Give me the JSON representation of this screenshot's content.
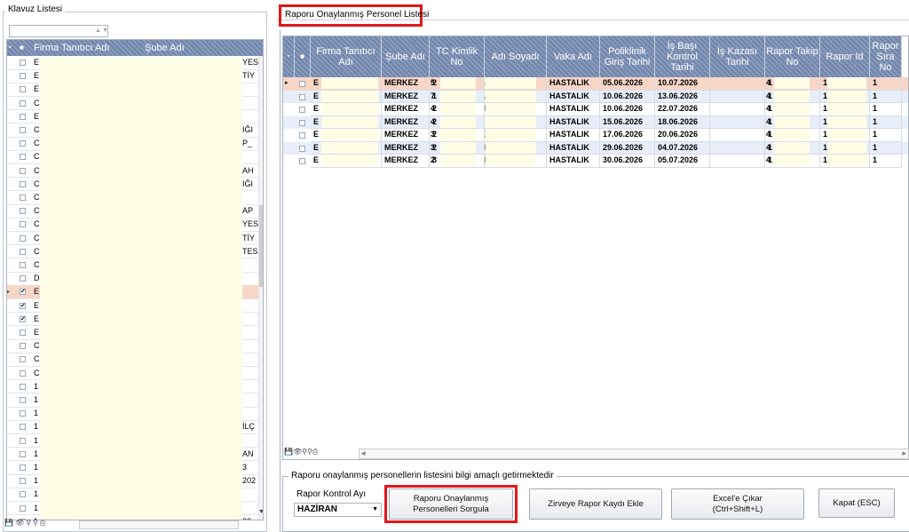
{
  "left_panel": {
    "title": "Klavuz Listesi",
    "columns": {
      "firma": "Firma Tanıtıcı Adı",
      "sube": "Şube Adı"
    },
    "rows": [
      {
        "firma": "E",
        "sube": "YES",
        "checked": false
      },
      {
        "firma": "E",
        "sube": "TİY",
        "checked": false
      },
      {
        "firma": "E",
        "sube": "",
        "checked": false
      },
      {
        "firma": "C",
        "sube": "",
        "checked": false
      },
      {
        "firma": "E",
        "sube": "",
        "checked": false
      },
      {
        "firma": "C",
        "sube": "IĞI",
        "checked": false
      },
      {
        "firma": "C",
        "sube": "P_",
        "checked": false
      },
      {
        "firma": "C",
        "sube": "",
        "checked": false
      },
      {
        "firma": "C",
        "sube": "AH",
        "checked": false
      },
      {
        "firma": "C",
        "sube": "IĞI",
        "checked": false
      },
      {
        "firma": "C",
        "sube": "",
        "checked": false
      },
      {
        "firma": "C",
        "sube": "AP",
        "checked": false
      },
      {
        "firma": "C",
        "sube": "YES",
        "checked": false
      },
      {
        "firma": "C",
        "sube": "TİY",
        "checked": false
      },
      {
        "firma": "C",
        "sube": "TES",
        "checked": false
      },
      {
        "firma": "C",
        "sube": "",
        "checked": false
      },
      {
        "firma": "D",
        "sube": "",
        "checked": false
      },
      {
        "firma": "E",
        "sube": "",
        "checked": true,
        "selected": true
      },
      {
        "firma": "E",
        "sube": "",
        "checked": true
      },
      {
        "firma": "E",
        "sube": "",
        "checked": true
      },
      {
        "firma": "E",
        "sube": "",
        "checked": false
      },
      {
        "firma": "C",
        "sube": "",
        "checked": false
      },
      {
        "firma": "C",
        "sube": "",
        "checked": false
      },
      {
        "firma": "C",
        "sube": "",
        "checked": false
      },
      {
        "firma": "1",
        "sube": "",
        "checked": false
      },
      {
        "firma": "1",
        "sube": "",
        "checked": false
      },
      {
        "firma": "1",
        "sube": "",
        "checked": false
      },
      {
        "firma": "1",
        "sube": "İLÇ",
        "checked": false
      },
      {
        "firma": "1",
        "sube": "",
        "checked": false
      },
      {
        "firma": "1",
        "sube": "AN",
        "checked": false
      },
      {
        "firma": "1",
        "sube": "3",
        "checked": false
      },
      {
        "firma": "1",
        "sube": "202",
        "checked": false
      },
      {
        "firma": "1",
        "sube": "",
        "checked": false
      },
      {
        "firma": "1",
        "sube": "",
        "checked": false
      },
      {
        "firma": "1",
        "sube": "23",
        "checked": false
      },
      {
        "firma": "1",
        "sube": "CA",
        "checked": false
      }
    ]
  },
  "tab": {
    "label": "Raporu Onaylanmış Personel Listesi"
  },
  "grid": {
    "columns": [
      "Firma Tanıtıcı Adı",
      "Şube Adı",
      "TC Kimlik No",
      "Adı Soyadı",
      "Vaka Adı",
      "Poliklinik Giriş Tarihi",
      "İş Başı Kontrol Tarihi",
      "İş Kazası Tarihi",
      "Rapor Takip No",
      "Rapor Id",
      "Rapor Sıra No"
    ],
    "rows": [
      {
        "firma": "E",
        "sube": "MERKEZ",
        "tc": "2",
        "tc_end": "5",
        "adi_end": ".",
        "vaka": "HASTALIK",
        "poliklinik": "05.06.2026",
        "isbasi": "10.07.2026",
        "kaza": "",
        "takip": "1",
        "takip_end": "4",
        "id": "1",
        "sira": "1"
      },
      {
        "firma": "E",
        "sube": "MERKEZ",
        "tc": "1",
        "tc_end": "7",
        "adi_end": "A",
        "vaka": "HASTALIK",
        "poliklinik": "10.06.2026",
        "isbasi": "13.06.2026",
        "kaza": "",
        "takip": "1",
        "takip_end": "4",
        "id": "1",
        "sira": "1"
      },
      {
        "firma": "E",
        "sube": "MERKEZ",
        "tc": "2",
        "tc_end": "4",
        "adi_end": "JN",
        "vaka": "HASTALIK",
        "poliklinik": "10.06.2026",
        "isbasi": "22.07.2026",
        "kaza": "",
        "takip": "1",
        "takip_end": "4",
        "id": "1",
        "sira": "1"
      },
      {
        "firma": "E",
        "sube": "MERKEZ",
        "tc": "2",
        "tc_end": "4",
        "adi_end": "",
        "vaka": "HASTALIK",
        "poliklinik": "15.06.2026",
        "isbasi": "18.06.2026",
        "kaza": "",
        "takip": "1",
        "takip_end": "4",
        "id": "1",
        "sira": "1"
      },
      {
        "firma": "E",
        "sube": "MERKEZ",
        "tc": "2",
        "tc_end": "3",
        "adi_end": "X",
        "vaka": "HASTALIK",
        "poliklinik": "17.06.2026",
        "isbasi": "20.06.2026",
        "kaza": "",
        "takip": "1",
        "takip_end": "4",
        "id": "1",
        "sira": "1"
      },
      {
        "firma": "E",
        "sube": "MERKEZ",
        "tc": "2",
        "tc_end": "3",
        "adi_end": "M",
        "vaka": "HASTALIK",
        "poliklinik": "29.06.2026",
        "isbasi": "04.07.2026",
        "kaza": "",
        "takip": "1",
        "takip_end": "4",
        "id": "1",
        "sira": "1"
      },
      {
        "firma": "E",
        "sube": "MERKEZ",
        "tc": "3",
        "tc_end": "2",
        "adi_end": "M",
        "vaka": "HASTALIK",
        "poliklinik": "30.06.2026",
        "isbasi": "05.07.2026",
        "kaza": "",
        "takip": "1",
        "takip_end": "4",
        "id": "1",
        "sira": "1"
      }
    ]
  },
  "bottom": {
    "title": "Raporu onaylanmış personellerin listesini bilgi amaçlı getirmektedir",
    "combo_label": "Rapor Kontrol Ayı",
    "combo_value": "HAZİRAN",
    "btn_query_1": "Raporu Onaylanmış",
    "btn_query_2": "Personelleri Sorgula",
    "btn_zirve": "Zirveye Rapor Kaydı Ekle",
    "btn_excel_1": "Excel'e Çıkar",
    "btn_excel_2": "(Ctrl+Shift+L)",
    "btn_close": "Kapat (ESC)"
  },
  "colors": {
    "header_blue": "#7a8fb5",
    "row_alt": "#e8eef9",
    "row_selected": "#f7d6c6",
    "mask_yellow": "#fefde6",
    "highlight_red": "#e01818"
  },
  "icons": [
    "save-icon",
    "eye-icon",
    "filter-icon",
    "search-icon",
    "print-icon",
    "arrow-left-icon",
    "arrow-right-icon"
  ]
}
